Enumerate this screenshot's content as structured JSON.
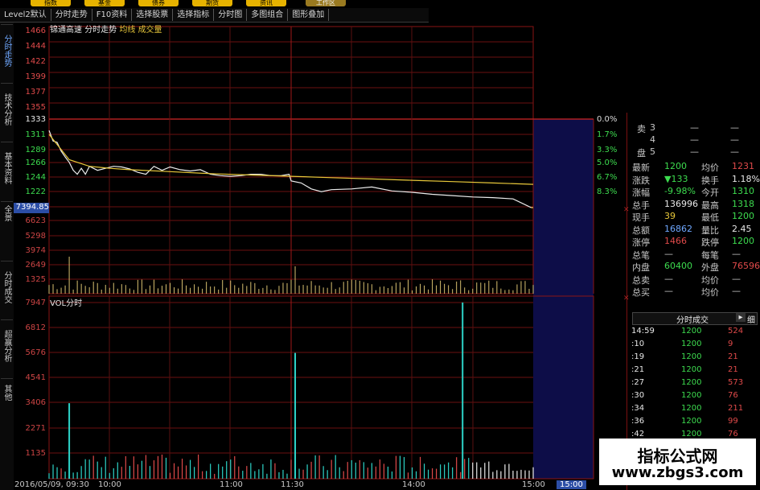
{
  "top_tabs": [
    "指数",
    "基金",
    "债券",
    "期货",
    "资讯",
    "工作区"
  ],
  "toolbar": [
    {
      "label": "Level2默认"
    },
    {
      "label": "分时走势"
    },
    {
      "label": "F10资料"
    },
    {
      "label": "选择股票"
    },
    {
      "label": "选择指标"
    },
    {
      "label": "分时图"
    },
    {
      "label": "多图组合"
    },
    {
      "label": "图形叠加"
    }
  ],
  "sidebar": [
    {
      "label": "分时走势",
      "active": true
    },
    {
      "label": "技术分析",
      "active": false
    },
    {
      "label": "基本资料",
      "active": false
    },
    {
      "label": "全景",
      "active": false
    },
    {
      "label": "分时成交",
      "active": false
    },
    {
      "label": "超赢分析",
      "active": false
    },
    {
      "label": "其他",
      "active": false
    }
  ],
  "chart_data": {
    "type": "line",
    "stock_name": "锦通高速",
    "title": "分时走势",
    "legend": [
      {
        "name": "均线",
        "color": "#e8c83a"
      },
      {
        "name": "成交量",
        "color": "#e8c83a"
      }
    ],
    "price_axis_labels": [
      "1466",
      "1444",
      "1422",
      "1399",
      "1377",
      "1355",
      "1333",
      "1311",
      "1289",
      "1266",
      "1244",
      "1222"
    ],
    "price_axis_highlight": "7394.85",
    "volume_axis_labels": [
      "6623",
      "5298",
      "3974",
      "2649",
      "1325"
    ],
    "pct_labels": [
      "0.0%",
      "1.7%",
      "3.3%",
      "5.0%",
      "6.7%",
      "8.3%"
    ],
    "price_ylim": [
      1200,
      1466
    ],
    "x_tick_labels": [
      "2016/05/09, 09:30",
      "10:00",
      "11:00",
      "11:30",
      "14:00",
      "15:00",
      "15:00"
    ],
    "series": [
      {
        "name": "价格",
        "color": "#ececec",
        "x": [
          0,
          2,
          4,
          6,
          8,
          10,
          12,
          14,
          16,
          18,
          20,
          24,
          28,
          32,
          36,
          40,
          44,
          48,
          52,
          56,
          60,
          65,
          70,
          75,
          80,
          85,
          90,
          95,
          100,
          105,
          110,
          115,
          119,
          120,
          125,
          130,
          135,
          140,
          150,
          160,
          170,
          180,
          190,
          200,
          210,
          220,
          230,
          239,
          240
        ],
        "values": [
          1316,
          1300,
          1298,
          1285,
          1276,
          1268,
          1256,
          1250,
          1259,
          1250,
          1262,
          1256,
          1259,
          1262,
          1261,
          1258,
          1253,
          1250,
          1262,
          1256,
          1261,
          1257,
          1255,
          1257,
          1250,
          1248,
          1247,
          1248,
          1250,
          1250,
          1248,
          1248,
          1250,
          1240,
          1237,
          1228,
          1224,
          1227,
          1228,
          1231,
          1225,
          1223,
          1220,
          1218,
          1216,
          1215,
          1213,
          1200,
          1200
        ]
      },
      {
        "name": "均线",
        "color": "#e8c83a",
        "x": [
          0,
          10,
          20,
          30,
          40,
          60,
          80,
          100,
          120,
          140,
          160,
          180,
          200,
          220,
          240
        ],
        "values": [
          1310,
          1272,
          1262,
          1259,
          1257,
          1254,
          1251,
          1249,
          1247,
          1245,
          1243,
          1241,
          1239,
          1237,
          1235
        ]
      }
    ],
    "volume_panel": {
      "label": "VOL分时",
      "axis_labels": [
        "7947",
        "6812",
        "5676",
        "4541",
        "3406",
        "2271",
        "1135"
      ],
      "ylim": [
        0,
        7947
      ],
      "spikes": [
        {
          "x": 122,
          "value": 5676
        },
        {
          "x": 205,
          "value": 7947
        },
        {
          "x": 10,
          "value": 3406
        }
      ]
    }
  },
  "quote": {
    "orderbook": [
      {
        "side": "卖",
        "level": "3",
        "price": "—",
        "vol": "—"
      },
      {
        "side": "",
        "level": "4",
        "price": "—",
        "vol": "—"
      },
      {
        "side": "盘",
        "level": "5",
        "price": "—",
        "vol": "—"
      }
    ],
    "rows": [
      {
        "l1": "最新",
        "v1": "1200",
        "c1": "#3ddc4f",
        "l2": "均价",
        "v2": "1231",
        "c2": "#e04a4a"
      },
      {
        "l1": "涨跌",
        "v1": "▼133",
        "c1": "#3ddc4f",
        "l2": "换手",
        "v2": "1.18%",
        "c2": "#e8e8e8"
      },
      {
        "l1": "涨幅",
        "v1": "-9.98%",
        "c1": "#3ddc4f",
        "l2": "今开",
        "v2": "1310",
        "c2": "#3ddc4f"
      },
      {
        "l1": "总手",
        "v1": "136996",
        "c1": "#e8e8e8",
        "l2": "最高",
        "v2": "1318",
        "c2": "#3ddc4f"
      },
      {
        "l1": "现手",
        "v1": "39",
        "c1": "#e8c83a",
        "l2": "最低",
        "v2": "1200",
        "c2": "#3ddc4f"
      },
      {
        "l1": "总额",
        "v1": "16862",
        "c1": "#6fa8ff",
        "l2": "量比",
        "v2": "2.45",
        "c2": "#e8e8e8"
      },
      {
        "l1": "涨停",
        "v1": "1466",
        "c1": "#e04a4a",
        "l2": "跌停",
        "v2": "1200",
        "c2": "#3ddc4f"
      },
      {
        "l1": "总笔",
        "v1": "—",
        "c1": "#c8c8c8",
        "l2": "每笔",
        "v2": "—",
        "c2": "#c8c8c8"
      },
      {
        "l1": "内盘",
        "v1": "60400",
        "c1": "#3ddc4f",
        "l2": "外盘",
        "v2": "76596",
        "c2": "#e04a4a"
      },
      {
        "l1": "总卖",
        "v1": "—",
        "c1": "#c8c8c8",
        "l2": "均价",
        "v2": "—",
        "c2": "#c8c8c8"
      },
      {
        "l1": "总买",
        "v1": "—",
        "c1": "#c8c8c8",
        "l2": "均价",
        "v2": "—",
        "c2": "#c8c8c8"
      }
    ],
    "trades_title": "分时成交",
    "trades_btn": "细",
    "trades": [
      {
        "time": "14:59",
        "price": "1200",
        "vol": "524",
        "color": "#e04a4a"
      },
      {
        "time": ":10",
        "price": "1200",
        "vol": "9",
        "color": "#e04a4a"
      },
      {
        "time": ":19",
        "price": "1200",
        "vol": "21",
        "color": "#e04a4a"
      },
      {
        "time": ":21",
        "price": "1200",
        "vol": "21",
        "color": "#e04a4a"
      },
      {
        "time": ":27",
        "price": "1200",
        "vol": "573",
        "color": "#e04a4a"
      },
      {
        "time": ":30",
        "price": "1200",
        "vol": "76",
        "color": "#e04a4a"
      },
      {
        "time": ":34",
        "price": "1200",
        "vol": "211",
        "color": "#e04a4a"
      },
      {
        "time": ":36",
        "price": "1200",
        "vol": "99",
        "color": "#e04a4a"
      },
      {
        "time": ":42",
        "price": "1200",
        "vol": "76",
        "color": "#e04a4a"
      }
    ]
  },
  "watermark": {
    "line1": "指标公式网",
    "line2": "www.zbgs3.com"
  }
}
